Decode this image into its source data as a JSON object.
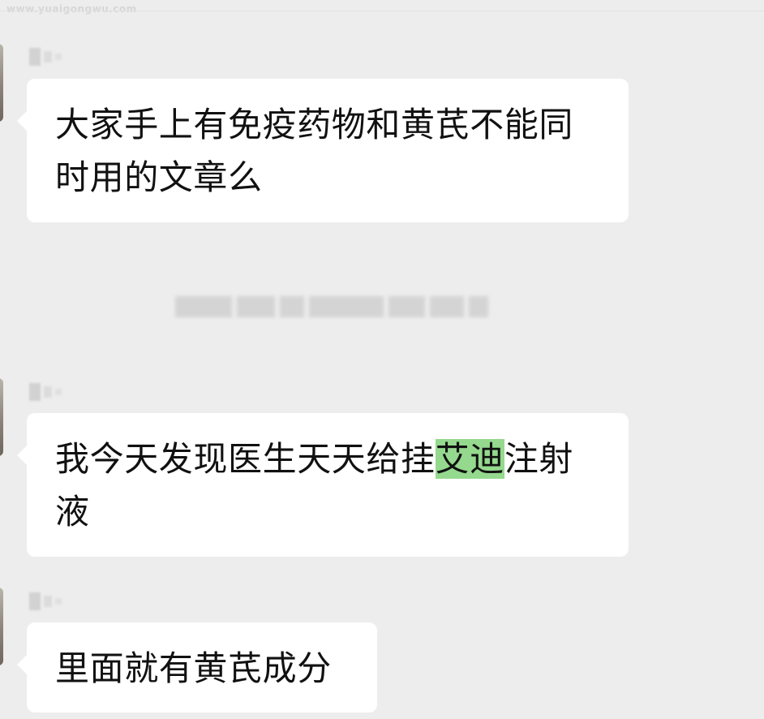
{
  "watermark": "www.yuaigongwu.com",
  "messages": [
    {
      "lines": [
        "大家手上有免疫药物和黄芪不能同",
        "时用的文章么"
      ]
    },
    {
      "line1_before": "我今天发现医生天天给挂",
      "line1_highlight": "艾迪",
      "line1_after": "注射",
      "line2": "液"
    },
    {
      "lines": [
        "里面就有黄芪成分"
      ]
    }
  ],
  "colors": {
    "background": "#ededed",
    "bubble": "#ffffff",
    "highlight": "#95d98e",
    "text": "#111111"
  }
}
